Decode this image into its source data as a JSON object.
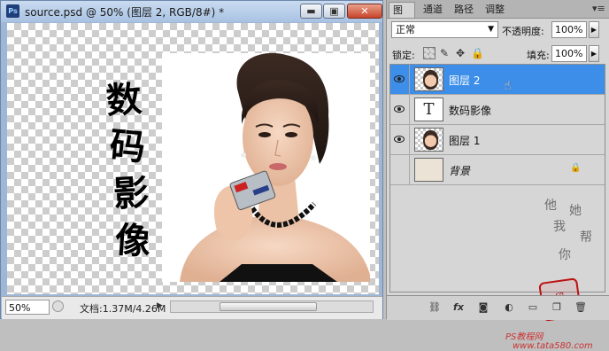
{
  "document": {
    "title": "source.psd @ 50% (图层 2, RGB/8#) *",
    "app_badge": "Ps",
    "window_buttons": {
      "minimize": "▬",
      "maximize": "▣",
      "close": "✕"
    },
    "canvas_text": [
      "数",
      "码",
      "影",
      "像"
    ],
    "status": {
      "zoom": "50%",
      "doc_info": "文档:1.37M/4.26M",
      "arrow": "▶"
    }
  },
  "panel": {
    "tabs": [
      {
        "label": "图层",
        "active": true
      },
      {
        "label": "通道",
        "active": false
      },
      {
        "label": "路径",
        "active": false
      },
      {
        "label": "调整",
        "active": false
      }
    ],
    "tab_menu_icon": "▾≡",
    "blend_mode": "正常",
    "opacity_label": "不透明度:",
    "opacity_value": "100%",
    "lock_label": "锁定:",
    "lock_icons": {
      "pixels": "✎",
      "position": "✥",
      "all": "🔒"
    },
    "fill_label": "填充:",
    "fill_value": "100%",
    "layers": [
      {
        "name": "图层 2",
        "selected": true,
        "visible": true,
        "thumb": "photo"
      },
      {
        "name": "数码影像",
        "selected": false,
        "visible": true,
        "thumb": "text",
        "thumb_glyph": "T"
      },
      {
        "name": "图层 1",
        "selected": false,
        "visible": true,
        "thumb": "photo"
      },
      {
        "name": "背景",
        "selected": false,
        "visible": false,
        "thumb": "background",
        "locked": true
      }
    ],
    "watermark_text": [
      "他",
      "她",
      "我",
      "帮",
      "你"
    ],
    "seal_text": "印",
    "footer_caption": "PS教程网",
    "footer_url": "www.tata580.com",
    "bottom_icons": {
      "link": "⛓",
      "fx": "fx",
      "mask": "◙",
      "adjust": "◐",
      "folder": "▭",
      "new": "❐",
      "trash": "🗑"
    }
  },
  "colors": {
    "selected_layer": "#3d8ee8",
    "title_bar": "#b7cde9",
    "close_button": "#c7452b"
  }
}
